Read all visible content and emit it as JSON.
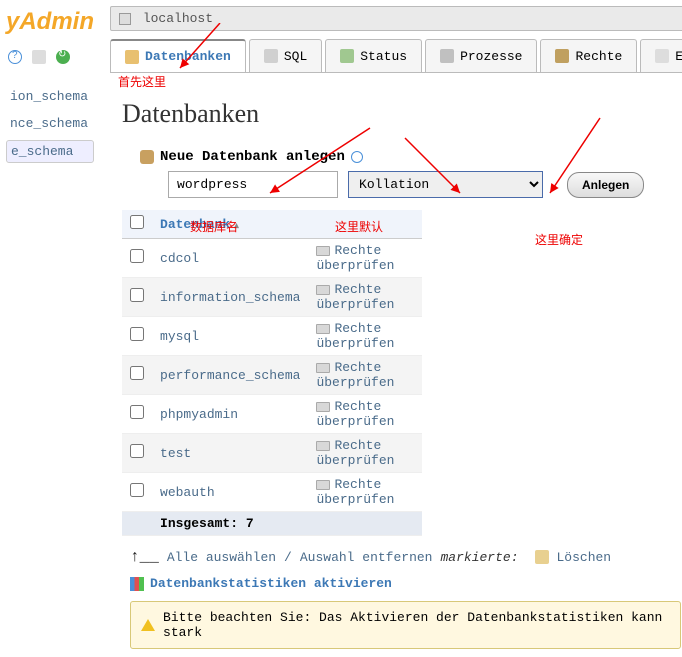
{
  "logo": "yAdmin",
  "breadcrumb": {
    "server": "localhost"
  },
  "tabs": [
    {
      "id": "db",
      "label": "Datenbanken",
      "active": true
    },
    {
      "id": "sql",
      "label": "SQL"
    },
    {
      "id": "status",
      "label": "Status"
    },
    {
      "id": "proc",
      "label": "Prozesse"
    },
    {
      "id": "rights",
      "label": "Rechte"
    },
    {
      "id": "ex",
      "label": "E"
    }
  ],
  "sidebar_links": [
    "ion_schema",
    "nce_schema",
    "e_schema"
  ],
  "page_title": "Datenbanken",
  "newdb": {
    "header": "Neue Datenbank anlegen",
    "name_value": "wordpress",
    "collation_selected": "Kollation",
    "submit_label": "Anlegen"
  },
  "table": {
    "col_db": "Datenbank",
    "rights_label": "Rechte überprüfen",
    "rows": [
      "cdcol",
      "information_schema",
      "mysql",
      "performance_schema",
      "phpmyadmin",
      "test",
      "webauth"
    ],
    "total_label": "Insgesamt:",
    "total_count": "7"
  },
  "select_row": {
    "select_all": "Alle auswählen",
    "sep": "/",
    "deselect": "Auswahl entfernen",
    "marked": "markierte:",
    "delete": "Löschen"
  },
  "activate_link": "Datenbankstatistiken aktivieren",
  "notice_text": "Bitte beachten Sie: Das Aktivieren der Datenbankstatistiken kann stark",
  "annotations": {
    "tabs_here": "首先这里",
    "db_name": "数据库名",
    "default_here": "这里默认",
    "confirm_here": "这里确定"
  }
}
